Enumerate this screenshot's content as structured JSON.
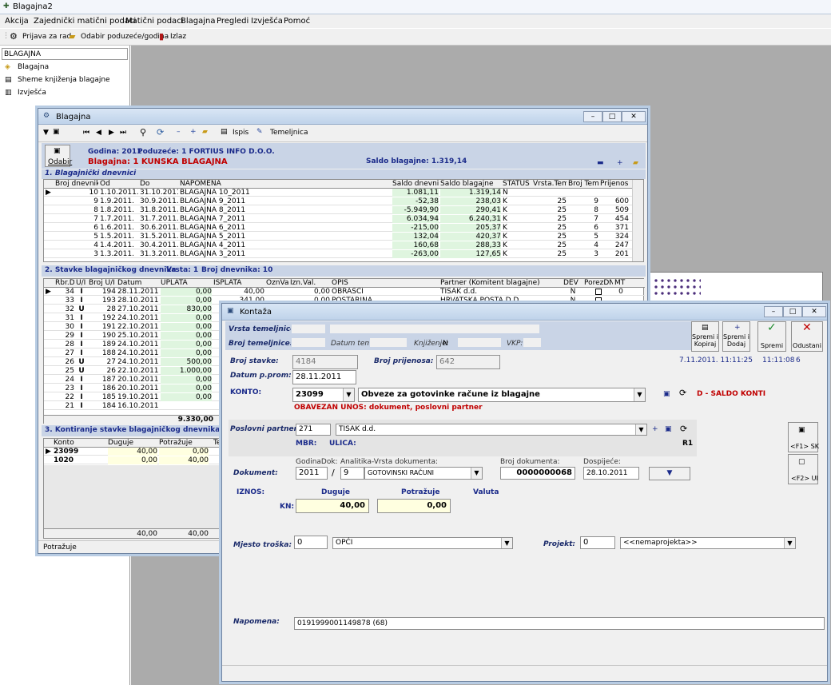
{
  "app": {
    "title": "Blagajna2"
  },
  "menu": [
    "Akcija",
    "Zajednički matični podaci",
    "Matični podaci",
    "Blagajna",
    "Pregledi",
    "Izvješća",
    "Pomoć"
  ],
  "toolbar": {
    "prijava": "Prijava za rad",
    "odabir": "Odabir poduzeće/godina",
    "izlaz": "Izlaz"
  },
  "left": {
    "header": "BLAGAJNA",
    "items": [
      "Blagajna",
      "Sheme knjiženja blagajne",
      "Izvješća"
    ]
  },
  "blagajna": {
    "title": "Blagajna",
    "tb": {
      "ispis": "Ispis",
      "temeljnica": "Temeljnica"
    },
    "odabir": "Odabir",
    "godina": "Godina: 2011",
    "poduzece": "Poduzeće: 1 FORTIUS INFO D.O.O.",
    "blag": "Blagajna: 1 KUNSKA BLAGAJNA",
    "saldo": "Saldo blagajne: 1.319,14",
    "sec1": "1. Blagajnički dnevnici",
    "h1": [
      "Broj dnevnika",
      "Od",
      "Do",
      "NAPOMENA",
      "Saldo dnevnika",
      "Saldo blagajne",
      "STATUS",
      "Vrsta.Tem",
      "Broj Tem.",
      "Prijenos"
    ],
    "rows1": [
      [
        "10",
        "1.10.2011.",
        "31.10.2011.",
        "BLAGAJNA 10_2011",
        "1.081,11",
        "1.319,14",
        "N",
        "",
        "",
        ""
      ],
      [
        "9",
        "1.9.2011.",
        "30.9.2011.",
        "BLAGAJNA 9_2011",
        "-52,38",
        "238,03",
        "K",
        "25",
        "9",
        "600"
      ],
      [
        "8",
        "1.8.2011.",
        "31.8.2011.",
        "BLAGAJNA 8_2011",
        "-5.949,90",
        "290,41",
        "K",
        "25",
        "8",
        "509"
      ],
      [
        "7",
        "1.7.2011.",
        "31.7.2011.",
        "BLAGAJNA 7_2011",
        "6.034,94",
        "6.240,31",
        "K",
        "25",
        "7",
        "454"
      ],
      [
        "6",
        "1.6.2011.",
        "30.6.2011.",
        "BLAGAJNA 6_2011",
        "-215,00",
        "205,37",
        "K",
        "25",
        "6",
        "371"
      ],
      [
        "5",
        "1.5.2011.",
        "31.5.2011.",
        "BLAGAJNA 5_2011",
        "132,04",
        "420,37",
        "K",
        "25",
        "5",
        "324"
      ],
      [
        "4",
        "1.4.2011.",
        "30.4.2011.",
        "BLAGAJNA 4_2011",
        "160,68",
        "288,33",
        "K",
        "25",
        "4",
        "247"
      ],
      [
        "3",
        "1.3.2011.",
        "31.3.2011.",
        "BLAGAJNA 3_2011",
        "-263,00",
        "127,65",
        "K",
        "25",
        "3",
        "201"
      ]
    ],
    "sec2": "2. Stavke blagajničkog dnevnika",
    "sec2vrsta": "Vrsta: 1",
    "sec2broj": "Broj dnevnika: 10",
    "h2": [
      "Rbr.D",
      "U/I",
      "Broj U/I",
      "Datum",
      "UPLATA",
      "ISPLATA",
      "OznVal",
      "Izn.Val.",
      "OPIS",
      "Partner (Komitent blagajne)",
      "DEV",
      "PorezDN",
      "MT"
    ],
    "rows2": [
      [
        "34",
        "I",
        "194",
        "28.11.2011.",
        "0,00",
        "40,00",
        "",
        "0,00",
        "OBRASCI",
        "TISAK d.d.",
        "N",
        "",
        "0"
      ],
      [
        "33",
        "I",
        "193",
        "28.10.2011.",
        "0,00",
        "341,00",
        "",
        "0,00",
        "POŠTARINA",
        "HRVATSKA POŠTA D.D.",
        "N",
        "",
        ""
      ],
      [
        "32",
        "U",
        "28",
        "27.10.2011.",
        "830,00",
        "",
        "",
        "",
        "",
        "",
        "",
        "",
        ""
      ],
      [
        "31",
        "I",
        "192",
        "24.10.2011.",
        "0,00",
        "",
        "",
        "",
        "",
        "",
        "",
        "",
        ""
      ],
      [
        "30",
        "I",
        "191",
        "22.10.2011.",
        "0,00",
        "",
        "",
        "",
        "",
        "",
        "",
        "",
        ""
      ],
      [
        "29",
        "I",
        "190",
        "25.10.2011.",
        "0,00",
        "",
        "",
        "",
        "",
        "",
        "",
        "",
        ""
      ],
      [
        "28",
        "I",
        "189",
        "24.10.2011.",
        "0,00",
        "",
        "",
        "",
        "",
        "",
        "",
        "",
        ""
      ],
      [
        "27",
        "I",
        "188",
        "24.10.2011.",
        "0,00",
        "",
        "",
        "",
        "",
        "",
        "",
        "",
        ""
      ],
      [
        "26",
        "U",
        "27",
        "24.10.2011.",
        "500,00",
        "",
        "",
        "",
        "",
        "",
        "",
        "",
        ""
      ],
      [
        "25",
        "U",
        "26",
        "22.10.2011.",
        "1.000,00",
        "",
        "",
        "",
        "",
        "",
        "",
        "",
        ""
      ],
      [
        "24",
        "I",
        "187",
        "20.10.2011.",
        "0,00",
        "",
        "",
        "",
        "",
        "",
        "",
        "",
        ""
      ],
      [
        "23",
        "I",
        "186",
        "20.10.2011.",
        "0,00",
        "",
        "",
        "",
        "",
        "",
        "",
        "",
        ""
      ],
      [
        "22",
        "I",
        "185",
        "19.10.2011.",
        "0,00",
        "",
        "",
        "",
        "",
        "",
        "",
        "",
        ""
      ],
      [
        "21",
        "I",
        "184",
        "16.10.2011.",
        "",
        "",
        "",
        "",
        "",
        "",
        "",
        "",
        ""
      ]
    ],
    "sum2": "9.330,00",
    "sec3": "3. Kontiranje stavke blagajničkog dnevnika Stavk",
    "h3": [
      "Konto",
      "Duguje",
      "Potražuje",
      "Te"
    ],
    "rows3": [
      [
        "23099",
        "40,00",
        "0,00"
      ],
      [
        "1020",
        "0,00",
        "40,00"
      ]
    ],
    "sum3": [
      "40,00",
      "40,00"
    ],
    "status": "Potražuje"
  },
  "kontaza": {
    "title": "Kontaža",
    "vrsta_tem": "Vrsta temeljnice:",
    "broj_tem": "Broj temeljnice:",
    "datum_tem": "Datum tem:",
    "knjizenje": "Knjiženje:",
    "knjizenje_val": "N",
    "vkp": "VKP:",
    "buttons": {
      "spremi_kopiraj": "Spremi i Kopiraj",
      "spremi_dodaj": "Spremi i Dodaj",
      "spremi": "Spremi",
      "odustani": "Odustani"
    },
    "broj_stavke_lbl": "Broj stavke:",
    "broj_stavke": "4184",
    "broj_prijenosa_lbl": "Broj prijenosa:",
    "broj_prijenosa": "642",
    "datum_lbl": "Datum p.prom:",
    "datum": "28.11.2011",
    "timestamp1": "7.11.2011. 11:11:25",
    "timestamp2": "11:11:08",
    "timestamp3": "6",
    "konto_lbl": "KONTO:",
    "konto": "23099",
    "konto_naziv": "Obveze za gotovinke račune iz blagajne",
    "konto_saldo": "D - SALDO KONTI",
    "obavezan": "OBAVEZAN UNOS: dokument, poslovni partner",
    "partner_lbl": "Poslovni partner:",
    "partner_sifra": "271",
    "partner_naziv": "TISAK d.d.",
    "mbr": "MBR:",
    "ulica": "ULICA:",
    "r1": "R1",
    "f1": "<F1> SK",
    "f2": "<F2> UI",
    "dok_lbl": "Dokument:",
    "godina_dok_lbl": "GodinaDok:",
    "godina_dok": "2011",
    "analitika_lbl": "Analitika-Vrsta dokumenta:",
    "analitika": "9",
    "analitika_naziv": "GOTOVINSKI RAČUNI",
    "broj_dok_lbl": "Broj dokumenta:",
    "broj_dok": "0000000068",
    "dospijece_lbl": "Dospijeće:",
    "dospijece": "28.10.2011",
    "iznos": "IZNOS:",
    "duguje_lbl": "Duguje",
    "potrazuje_lbl": "Potražuje",
    "valuta_lbl": "Valuta",
    "kn": "KN:",
    "duguje": "40,00",
    "potrazuje": "0,00",
    "mt_lbl": "Mjesto troška:",
    "mt": "0",
    "mt_naziv": "OPĆI",
    "projekt_lbl": "Projekt:",
    "projekt": "0",
    "projekt_naziv": "<<nemaprojekta>>",
    "napomena_lbl": "Napomena:",
    "napomena": "0191999001149878 (68)"
  }
}
